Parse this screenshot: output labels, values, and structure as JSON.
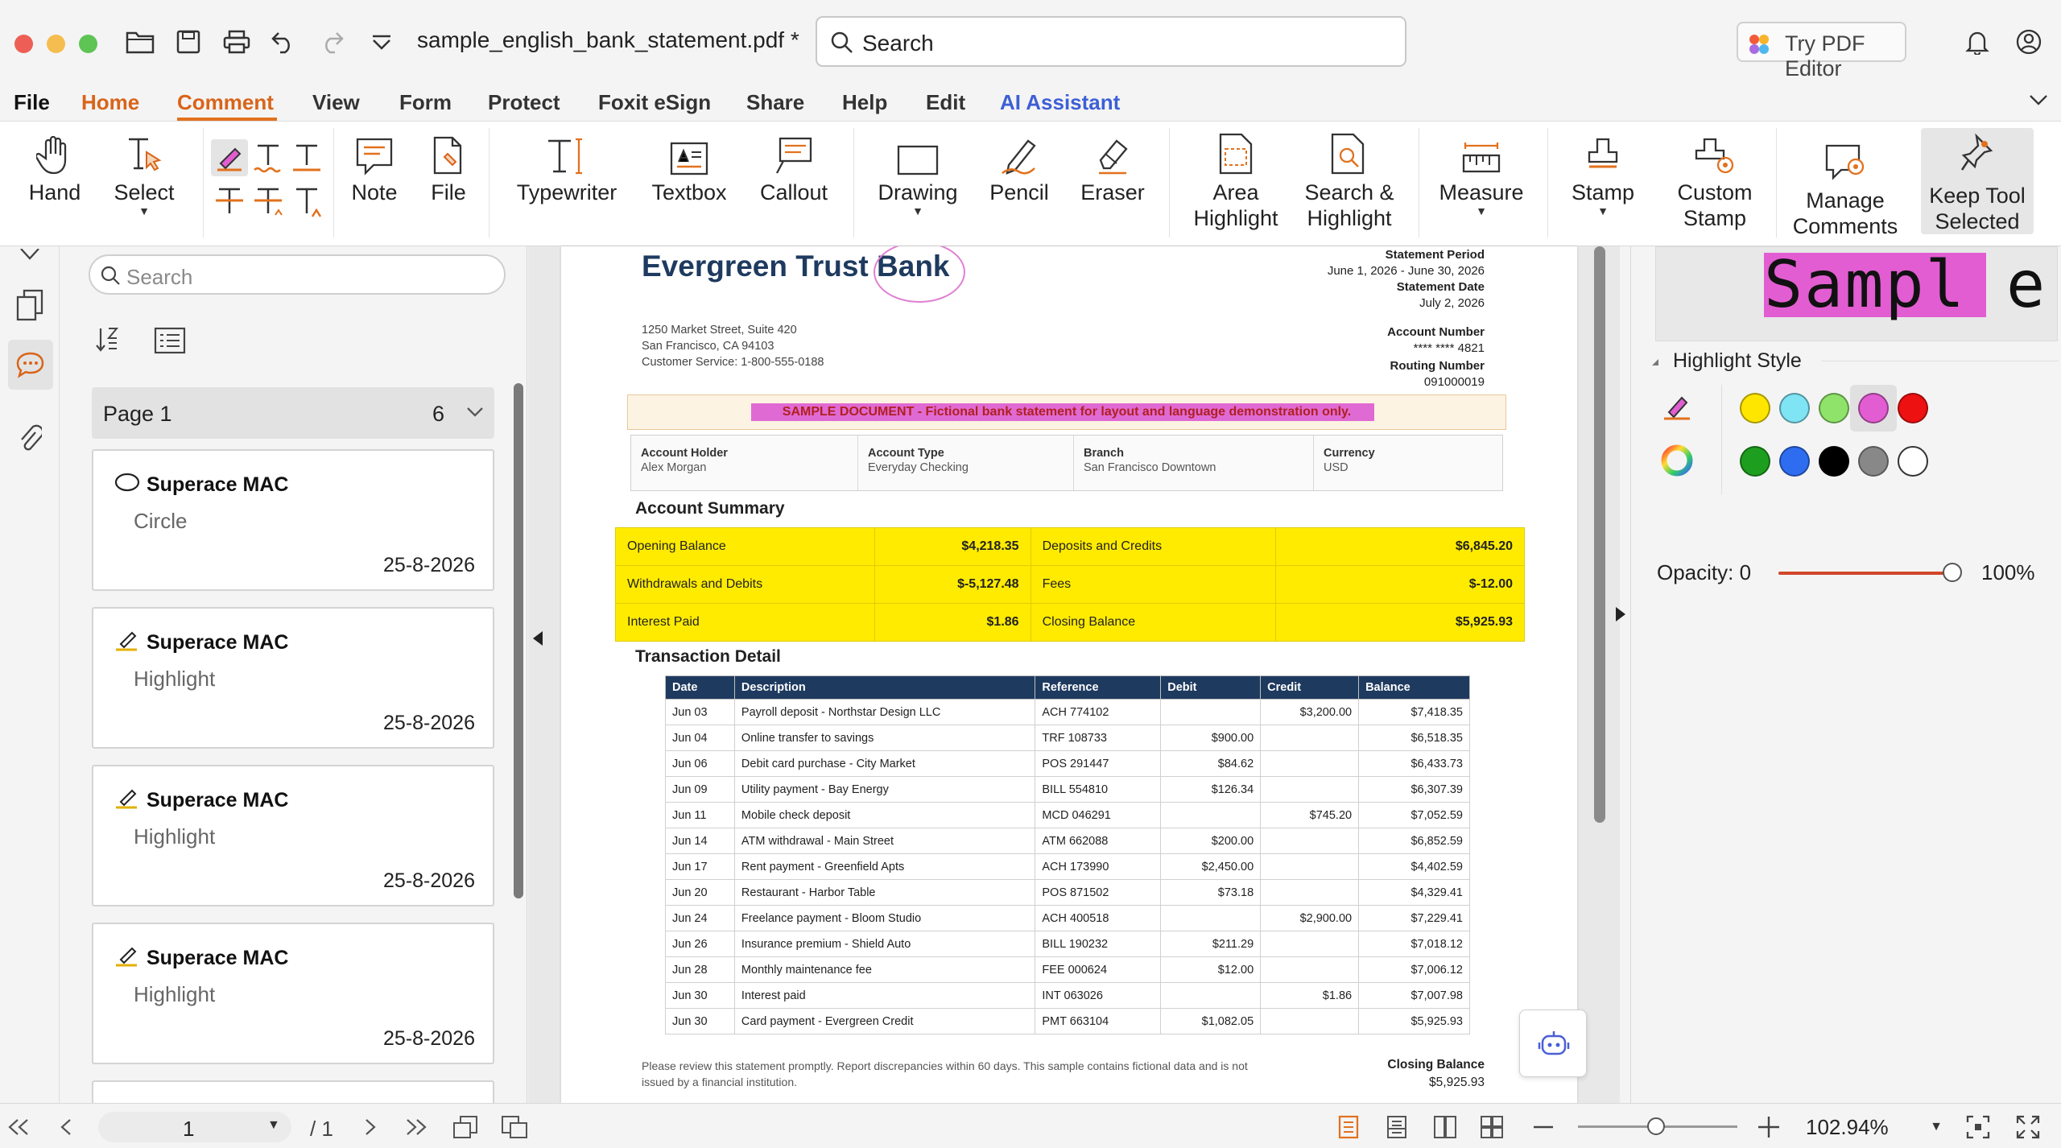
{
  "window": {
    "title": "sample_english_bank_statement.pdf *",
    "search_placeholder": "Search",
    "try_pdf_editor": "Try PDF Editor"
  },
  "menu": [
    "File",
    "Home",
    "Comment",
    "View",
    "Form",
    "Protect",
    "Foxit eSign",
    "Share",
    "Help",
    "Edit",
    "AI Assistant"
  ],
  "ribbon": {
    "hand": "Hand",
    "select": "Select",
    "note": "Note",
    "file": "File",
    "typewriter": "Typewriter",
    "textbox": "Textbox",
    "callout": "Callout",
    "drawing": "Drawing",
    "pencil": "Pencil",
    "eraser": "Eraser",
    "area_highlight_1": "Area",
    "area_highlight_2": "Highlight",
    "search_highlight_1": "Search &",
    "search_highlight_2": "Highlight",
    "measure": "Measure",
    "stamp": "Stamp",
    "custom_stamp_1": "Custom",
    "custom_stamp_2": "Stamp",
    "manage_comments_1": "Manage",
    "manage_comments_2": "Comments",
    "keep_tool_1": "Keep Tool",
    "keep_tool_2": "Selected"
  },
  "comments_panel": {
    "search_placeholder": "Search",
    "page_label": "Page 1",
    "page_count": "6",
    "cards": [
      {
        "author": "Superace MAC",
        "type": "Circle",
        "date": "25-8-2026"
      },
      {
        "author": "Superace MAC",
        "type": "Highlight",
        "date": "25-8-2026"
      },
      {
        "author": "Superace MAC",
        "type": "Highlight",
        "date": "25-8-2026"
      },
      {
        "author": "Superace MAC",
        "type": "Highlight",
        "date": "25-8-2026"
      }
    ]
  },
  "document": {
    "bank_name_1": "Evergreen Trust",
    "bank_name_2": "Bank",
    "address": [
      "1250 Market Street, Suite 420",
      "San Francisco, CA 94103",
      "Customer Service: 1-800-555-0188"
    ],
    "statement_period_label": "Statement Period",
    "statement_period": "June 1, 2026 - June 30, 2026",
    "statement_date_label": "Statement Date",
    "statement_date": "July 2, 2026",
    "account_number_label": "Account Number",
    "account_number": "**** **** 4821",
    "routing_number_label": "Routing Number",
    "routing_number": "091000019",
    "banner": "SAMPLE DOCUMENT - Fictional bank statement for layout and language demonstration only.",
    "info": [
      {
        "label": "Account Holder",
        "value": "Alex Morgan"
      },
      {
        "label": "Account Type",
        "value": "Everyday Checking"
      },
      {
        "label": "Branch",
        "value": "San Francisco Downtown"
      },
      {
        "label": "Currency",
        "value": "USD"
      }
    ],
    "summary_title": "Account Summary",
    "summary": [
      [
        "Opening Balance",
        "$4,218.35",
        "Deposits and Credits",
        "$6,845.20"
      ],
      [
        "Withdrawals and Debits",
        "$-5,127.48",
        "Fees",
        "$-12.00"
      ],
      [
        "Interest Paid",
        "$1.86",
        "Closing Balance",
        "$5,925.93"
      ]
    ],
    "transactions_title": "Transaction Detail",
    "transaction_headers": [
      "Date",
      "Description",
      "Reference",
      "Debit",
      "Credit",
      "Balance"
    ],
    "transactions": [
      [
        "Jun 03",
        "Payroll deposit - Northstar Design LLC",
        "ACH 774102",
        "",
        "$3,200.00",
        "$7,418.35"
      ],
      [
        "Jun 04",
        "Online transfer to savings",
        "TRF 108733",
        "$900.00",
        "",
        "$6,518.35"
      ],
      [
        "Jun 06",
        "Debit card purchase - City Market",
        "POS 291447",
        "$84.62",
        "",
        "$6,433.73"
      ],
      [
        "Jun 09",
        "Utility payment - Bay Energy",
        "BILL 554810",
        "$126.34",
        "",
        "$6,307.39"
      ],
      [
        "Jun 11",
        "Mobile check deposit",
        "MCD 046291",
        "",
        "$745.20",
        "$7,052.59"
      ],
      [
        "Jun 14",
        "ATM withdrawal - Main Street",
        "ATM 662088",
        "$200.00",
        "",
        "$6,852.59"
      ],
      [
        "Jun 17",
        "Rent payment - Greenfield Apts",
        "ACH 173990",
        "$2,450.00",
        "",
        "$4,402.59"
      ],
      [
        "Jun 20",
        "Restaurant - Harbor Table",
        "POS 871502",
        "$73.18",
        "",
        "$4,329.41"
      ],
      [
        "Jun 24",
        "Freelance payment - Bloom Studio",
        "ACH 400518",
        "",
        "$2,900.00",
        "$7,229.41"
      ],
      [
        "Jun 26",
        "Insurance premium - Shield Auto",
        "BILL 190232",
        "$211.29",
        "",
        "$7,018.12"
      ],
      [
        "Jun 28",
        "Monthly maintenance fee",
        "FEE 000624",
        "$12.00",
        "",
        "$7,006.12"
      ],
      [
        "Jun 30",
        "Interest paid",
        "INT 063026",
        "",
        "$1.86",
        "$7,007.98"
      ],
      [
        "Jun 30",
        "Card payment - Evergreen Credit",
        "PMT 663104",
        "$1,082.05",
        "",
        "$5,925.93"
      ]
    ],
    "footnote": "Please review this statement promptly. Report discrepancies within 60 days. This sample contains fictional data and is not issued by a financial institution.",
    "closing_balance_label": "Closing Balance",
    "closing_balance": "$5,925.93"
  },
  "right_panel": {
    "preview_text": "Sampl e",
    "highlight_style_label": "Highlight Style",
    "colors": [
      "#ffe600",
      "#7fe4f4",
      "#8fe36a",
      "#e25dd2",
      "#ee1111",
      "#1e9e1e",
      "#2f6df0",
      "#000000",
      "#888888",
      "#ffffff"
    ],
    "selected_color": "#e25dd2",
    "opacity_label": "Opacity: 0",
    "opacity_value": "100%"
  },
  "status_bar": {
    "page_current": "1",
    "page_total": "/ 1",
    "zoom": "102.94%"
  }
}
